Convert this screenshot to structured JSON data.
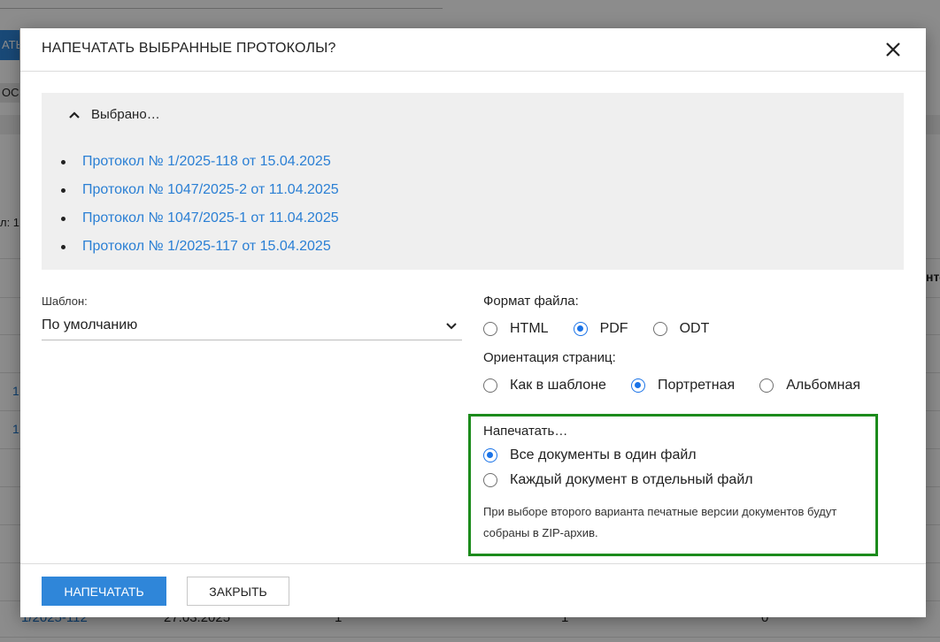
{
  "background": {
    "button_fragment": "АТЬ",
    "chip_fragment": "ОС",
    "count_fragment": "л: 1",
    "column_fragment": "нто",
    "row_links": [
      "1",
      "1"
    ],
    "last_row": {
      "number": "1/2025-112",
      "date": "27.03.2025",
      "col3": "1",
      "col4": "1",
      "col5": "0"
    }
  },
  "modal": {
    "title": "НАПЕЧАТАТЬ ВЫБРАННЫЕ ПРОТОКОЛЫ?",
    "selected": {
      "toggle_label": "Выбрано…",
      "items": [
        "Протокол № 1/2025-118 от 15.04.2025",
        "Протокол № 1047/2025-2 от 11.04.2025",
        "Протокол № 1047/2025-1 от 11.04.2025",
        "Протокол № 1/2025-117 от 15.04.2025"
      ]
    },
    "template": {
      "label": "Шаблон:",
      "value": "По умолчанию"
    },
    "file_format": {
      "label": "Формат файла:",
      "options": [
        "HTML",
        "PDF",
        "ODT"
      ],
      "selected": "PDF"
    },
    "orientation": {
      "label": "Ориентация страниц:",
      "options": [
        "Как в шаблоне",
        "Портретная",
        "Альбомная"
      ],
      "selected": "Портретная"
    },
    "print_mode": {
      "label": "Напечатать…",
      "options": [
        "Все документы в один файл",
        "Каждый документ в отдельный файл"
      ],
      "selected": "Все документы в один файл",
      "hint": "При выборе второго варианта печатные версии документов будут собраны в ZIP-архив."
    },
    "footer": {
      "print_label": "НАПЕЧАТАТЬ",
      "close_label": "ЗАКРЫТЬ"
    }
  },
  "colors": {
    "primary": "#2f86d9",
    "link": "#2a7fd4",
    "radio_checked": "#1a73e8",
    "highlight_border": "#1c8b1c"
  }
}
